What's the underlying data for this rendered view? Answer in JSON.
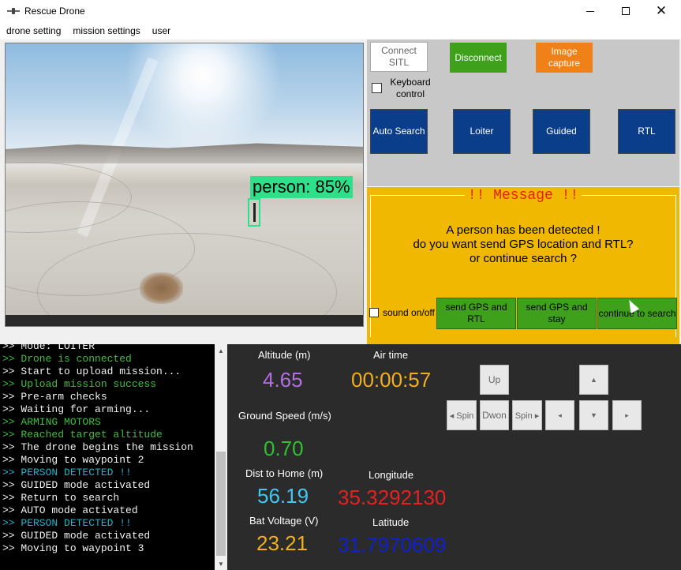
{
  "window": {
    "title": "Rescue Drone",
    "app_icon": "drone-icon"
  },
  "menu": [
    "drone setting",
    "mission settings",
    "user"
  ],
  "video": {
    "detection_label": "person: 85%"
  },
  "controls": {
    "connect_label": "Connect SITL",
    "disconnect_label": "Disconnect",
    "image_capture_label": "Image capture",
    "keyboard_label": "Keyboard control",
    "auto_search_label": "Auto Search",
    "loiter_label": "Loiter",
    "guided_label": "Guided",
    "rtl_label": "RTL",
    "colors": {
      "green": "#3fa01c",
      "orange": "#f08018",
      "blue": "#0a3d8a"
    }
  },
  "message": {
    "title": "!! Message !!",
    "line1": "A person has been detected !",
    "line2": "do you want send GPS location and RTL?",
    "line3": "or continue search ?",
    "sound_label": "sound on/off",
    "send_gps_rtl_label": "send GPS and RTL",
    "send_gps_stay_label": "send GPS and stay",
    "continue_label": "continue to search",
    "colors": {
      "panel": "#f0b800",
      "title": "#e8200a"
    }
  },
  "console": {
    "lines": [
      {
        "text": ">> Mode: LOITER",
        "color": "white"
      },
      {
        "text": ">> Drone is connected",
        "color": "green"
      },
      {
        "text": ">> Start to upload mission...",
        "color": "white"
      },
      {
        "text": ">> Upload mission success",
        "color": "green"
      },
      {
        "text": ">> Pre-arm checks",
        "color": "white"
      },
      {
        "text": ">> Waiting for arming...",
        "color": "white"
      },
      {
        "text": ">> ARMING MOTORS",
        "color": "green"
      },
      {
        "text": ">> Reached target altitude",
        "color": "green"
      },
      {
        "text": ">> The drone begins the mission",
        "color": "white"
      },
      {
        "text": ">> Moving to waypoint 2",
        "color": "white"
      },
      {
        "text": ">> PERSON DETECTED !!",
        "color": "cyan"
      },
      {
        "text": ">> GUIDED mode activated",
        "color": "white"
      },
      {
        "text": ">> Return to search",
        "color": "white"
      },
      {
        "text": ">> AUTO mode activated",
        "color": "white"
      },
      {
        "text": ">> PERSON DETECTED !!",
        "color": "cyan"
      },
      {
        "text": ">> GUIDED mode activated",
        "color": "white"
      },
      {
        "text": ">> Moving to waypoint 3",
        "color": "white"
      }
    ]
  },
  "telemetry": {
    "altitude": {
      "label": "Altitude (m)",
      "value": "4.65",
      "color": "#b070e0"
    },
    "air_time": {
      "label": "Air time",
      "value": "00:00:57",
      "color": "#f0b020"
    },
    "ground_speed": {
      "label": "Ground Speed (m/s)",
      "value": "0.70",
      "color": "#30c030"
    },
    "dist_home": {
      "label": "Dist to Home (m)",
      "value": "56.19",
      "color": "#40c8f0"
    },
    "longitude": {
      "label": "Longitude",
      "value": "35.3292130",
      "color": "#e82020"
    },
    "bat_voltage": {
      "label": "Bat Voltage (V)",
      "value": "23.21",
      "color": "#f0b020"
    },
    "latitude": {
      "label": "Latitude",
      "value": "31.7970609",
      "color": "#1020d0"
    }
  },
  "jog": {
    "up_label": "Up",
    "down_label": "Dwon",
    "spin_left_label": "◂ Spin",
    "spin_right_label": "Spin ▸",
    "forward_icon": "arrow-up-icon",
    "backward_icon": "arrow-down-icon",
    "left_icon": "arrow-left-icon",
    "right_icon": "arrow-right-icon"
  }
}
